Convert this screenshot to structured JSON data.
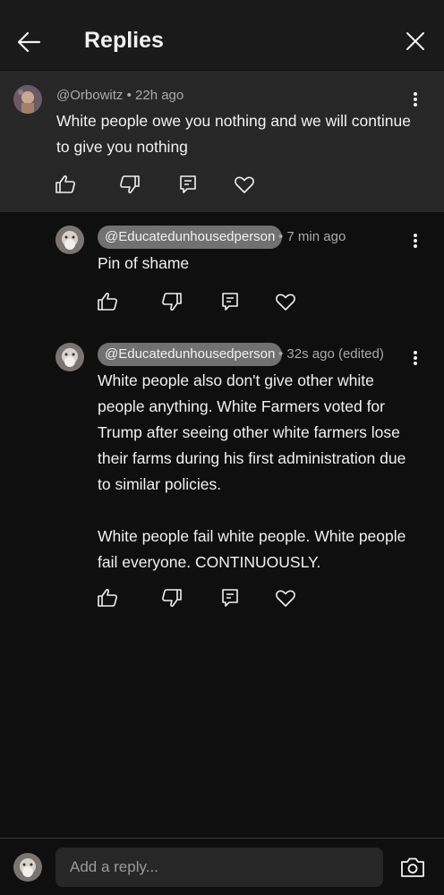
{
  "header": {
    "title": "Replies"
  },
  "parent_comment": {
    "author": "@Orbowitz",
    "time": "22h ago",
    "text_lines": [
      "White people owe you nothing and we will continue",
      "to give you nothing"
    ]
  },
  "replies": [
    {
      "author": "@Educatedunhousedperson",
      "time": "7 min ago",
      "text_lines": [
        "Pin of shame"
      ]
    },
    {
      "author": "@Educatedunhousedperson",
      "time": "32s ago (edited)",
      "text_lines": [
        "White people also don't give other white",
        "people anything. White Farmers voted for",
        "Trump after seeing other white farmers lose",
        "their farms during his first administration due",
        "to similar policies.",
        "",
        "White people fail white people. White people",
        "fail everyone. CONTINUOUSLY."
      ]
    }
  ],
  "footer": {
    "placeholder": "Add a reply..."
  },
  "icons": {
    "back": "arrow-left-icon",
    "close": "close-icon",
    "like": "thumbs-up-icon",
    "dislike": "thumbs-down-icon",
    "reply": "comment-icon",
    "heart": "heart-icon",
    "more": "more-vertical-icon",
    "camera": "camera-icon"
  },
  "colors": {
    "background": "#0f0f0f",
    "highlight": "#272727",
    "mention_chip": "#717171",
    "secondary_text": "#aaaaaa"
  }
}
